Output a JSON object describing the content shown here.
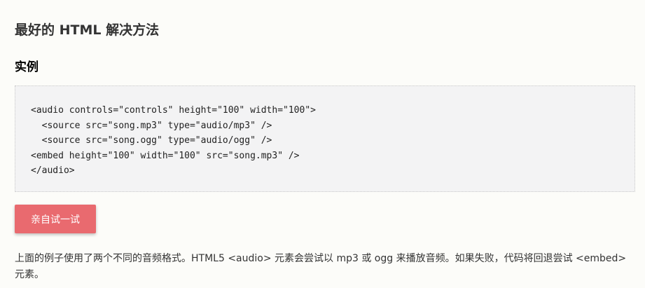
{
  "heading": {
    "title": "最好的 HTML 解决方法",
    "subtitle": "实例"
  },
  "example": {
    "code_lines": [
      "<audio controls=\"controls\" height=\"100\" width=\"100\">",
      "  <source src=\"song.mp3\" type=\"audio/mp3\" />",
      "  <source src=\"song.ogg\" type=\"audio/ogg\" />",
      "<embed height=\"100\" width=\"100\" src=\"song.mp3\" />",
      "</audio>"
    ]
  },
  "try_button": {
    "label": "亲自试一试"
  },
  "description": {
    "text": "上面的例子使用了两个不同的音频格式。HTML5 <audio> 元素会尝试以 mp3 或 ogg 来播放音频。如果失败，代码将回退尝试 <embed> 元素。"
  },
  "colors": {
    "background": "#fcfcf9",
    "code_background": "#f3f3f4",
    "button": "#e96a6f",
    "button_text": "#ffffff"
  }
}
